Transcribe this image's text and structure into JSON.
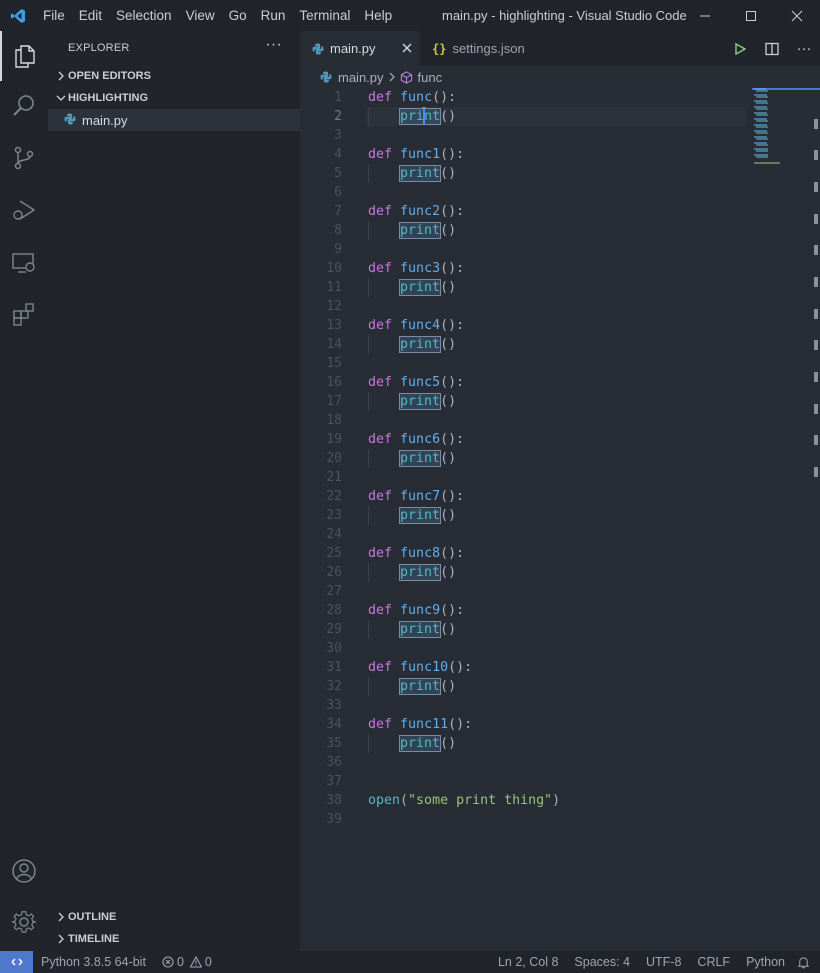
{
  "menu": [
    "File",
    "Edit",
    "Selection",
    "View",
    "Go",
    "Run",
    "Terminal",
    "Help"
  ],
  "window_title": "main.py - highlighting - Visual Studio Code",
  "window_controls": {
    "minimize": "—",
    "maximize": "☐",
    "close": "✕"
  },
  "sidebar": {
    "title": "EXPLORER",
    "more": "···",
    "open_editors": "OPEN EDITORS",
    "folder": "HIGHLIGHTING",
    "files": [
      "main.py"
    ],
    "outline": "OUTLINE",
    "timeline": "TIMELINE"
  },
  "tabs": [
    {
      "label": "main.py",
      "active": true
    },
    {
      "label": "settings.json",
      "active": false
    }
  ],
  "breadcrumb": {
    "file": "main.py",
    "symbol": "func"
  },
  "editor": {
    "current_line": 2,
    "lines": [
      {
        "n": "1",
        "def": "def",
        "name": "func",
        "tail": "():"
      },
      {
        "n": "2",
        "call": "print",
        "tail": "()"
      },
      {
        "n": "3"
      },
      {
        "n": "4",
        "def": "def",
        "name": "func1",
        "tail": "():"
      },
      {
        "n": "5",
        "call": "print",
        "tail": "()"
      },
      {
        "n": "6"
      },
      {
        "n": "7",
        "def": "def",
        "name": "func2",
        "tail": "():"
      },
      {
        "n": "8",
        "call": "print",
        "tail": "()"
      },
      {
        "n": "9"
      },
      {
        "n": "10",
        "def": "def",
        "name": "func3",
        "tail": "():"
      },
      {
        "n": "11",
        "call": "print",
        "tail": "()"
      },
      {
        "n": "12"
      },
      {
        "n": "13",
        "def": "def",
        "name": "func4",
        "tail": "():"
      },
      {
        "n": "14",
        "call": "print",
        "tail": "()"
      },
      {
        "n": "15"
      },
      {
        "n": "16",
        "def": "def",
        "name": "func5",
        "tail": "():"
      },
      {
        "n": "17",
        "call": "print",
        "tail": "()"
      },
      {
        "n": "18"
      },
      {
        "n": "19",
        "def": "def",
        "name": "func6",
        "tail": "():"
      },
      {
        "n": "20",
        "call": "print",
        "tail": "()"
      },
      {
        "n": "21"
      },
      {
        "n": "22",
        "def": "def",
        "name": "func7",
        "tail": "():"
      },
      {
        "n": "23",
        "call": "print",
        "tail": "()"
      },
      {
        "n": "24"
      },
      {
        "n": "25",
        "def": "def",
        "name": "func8",
        "tail": "():"
      },
      {
        "n": "26",
        "call": "print",
        "tail": "()"
      },
      {
        "n": "27"
      },
      {
        "n": "28",
        "def": "def",
        "name": "func9",
        "tail": "():"
      },
      {
        "n": "29",
        "call": "print",
        "tail": "()"
      },
      {
        "n": "30"
      },
      {
        "n": "31",
        "def": "def",
        "name": "func10",
        "tail": "():"
      },
      {
        "n": "32",
        "call": "print",
        "tail": "()"
      },
      {
        "n": "33"
      },
      {
        "n": "34",
        "def": "def",
        "name": "func11",
        "tail": "():"
      },
      {
        "n": "35",
        "call": "print",
        "tail": "()"
      },
      {
        "n": "36"
      },
      {
        "n": "37"
      },
      {
        "n": "38",
        "open": "open",
        "open_paren": "(",
        "str": "\"some print thing\"",
        "close_paren": ")"
      },
      {
        "n": "39"
      }
    ]
  },
  "statusbar": {
    "python": "Python 3.8.5 64-bit",
    "errors": "0",
    "warnings": "0",
    "position": "Ln 2, Col 8",
    "spaces": "Spaces: 4",
    "encoding": "UTF-8",
    "eol": "CRLF",
    "language": "Python"
  },
  "colors": {
    "keyword": "#c678dd",
    "function": "#61afef",
    "builtin": "#56b6c2",
    "string": "#98c379",
    "accent": "#4d78cc"
  }
}
